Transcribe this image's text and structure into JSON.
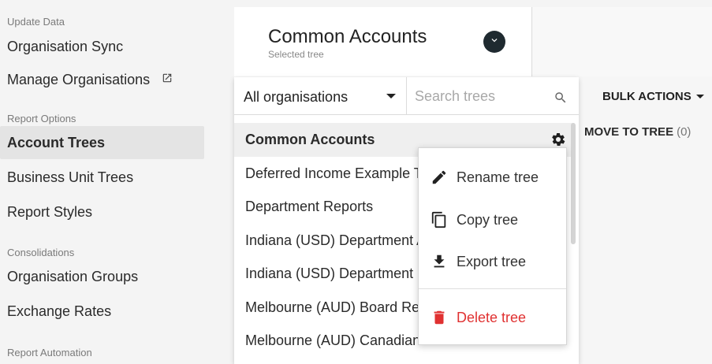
{
  "sidebar": {
    "sections": [
      {
        "title": "Update Data",
        "items": [
          {
            "label": "Organisation Sync"
          },
          {
            "label": "Manage Organisations"
          }
        ]
      },
      {
        "title": "Report Options",
        "items": [
          {
            "label": "Account Trees"
          },
          {
            "label": "Business Unit Trees"
          },
          {
            "label": "Report Styles"
          }
        ]
      },
      {
        "title": "Consolidations",
        "items": [
          {
            "label": "Organisation Groups"
          },
          {
            "label": "Exchange Rates"
          }
        ]
      },
      {
        "title": "Report Automation",
        "items": []
      }
    ],
    "active_item": "Account Trees"
  },
  "header": {
    "tree_title": "Common Accounts",
    "tree_subtitle": "Selected tree"
  },
  "tree_panel": {
    "org_filter": {
      "value": "All organisations"
    },
    "search": {
      "placeholder": "Search trees",
      "value": ""
    },
    "trees": [
      {
        "label": "Common Accounts",
        "selected": true
      },
      {
        "label": "Deferred Income Example TA"
      },
      {
        "label": "Department Reports"
      },
      {
        "label": "Indiana (USD) Department A"
      },
      {
        "label": "Indiana (USD) Department B"
      },
      {
        "label": "Melbourne (AUD) Board Rep"
      },
      {
        "label": "Melbourne (AUD) Canadian"
      }
    ]
  },
  "bulk_actions": {
    "label": "BULK ACTIONS"
  },
  "move_to_tree": {
    "label": "MOVE TO TREE",
    "count": "(0)"
  },
  "context_menu": {
    "items": [
      {
        "label": "Rename tree",
        "icon": "pencil-icon"
      },
      {
        "label": "Copy tree",
        "icon": "copy-icon"
      },
      {
        "label": "Export tree",
        "icon": "download-icon"
      },
      {
        "label": "Delete tree",
        "icon": "trash-icon",
        "danger": true
      }
    ]
  },
  "colors": {
    "danger": "#e03131",
    "dark_toggle": "#1f2a30",
    "sidebar_bg": "#f4f4f4",
    "active_bg": "#e4e4e4"
  }
}
